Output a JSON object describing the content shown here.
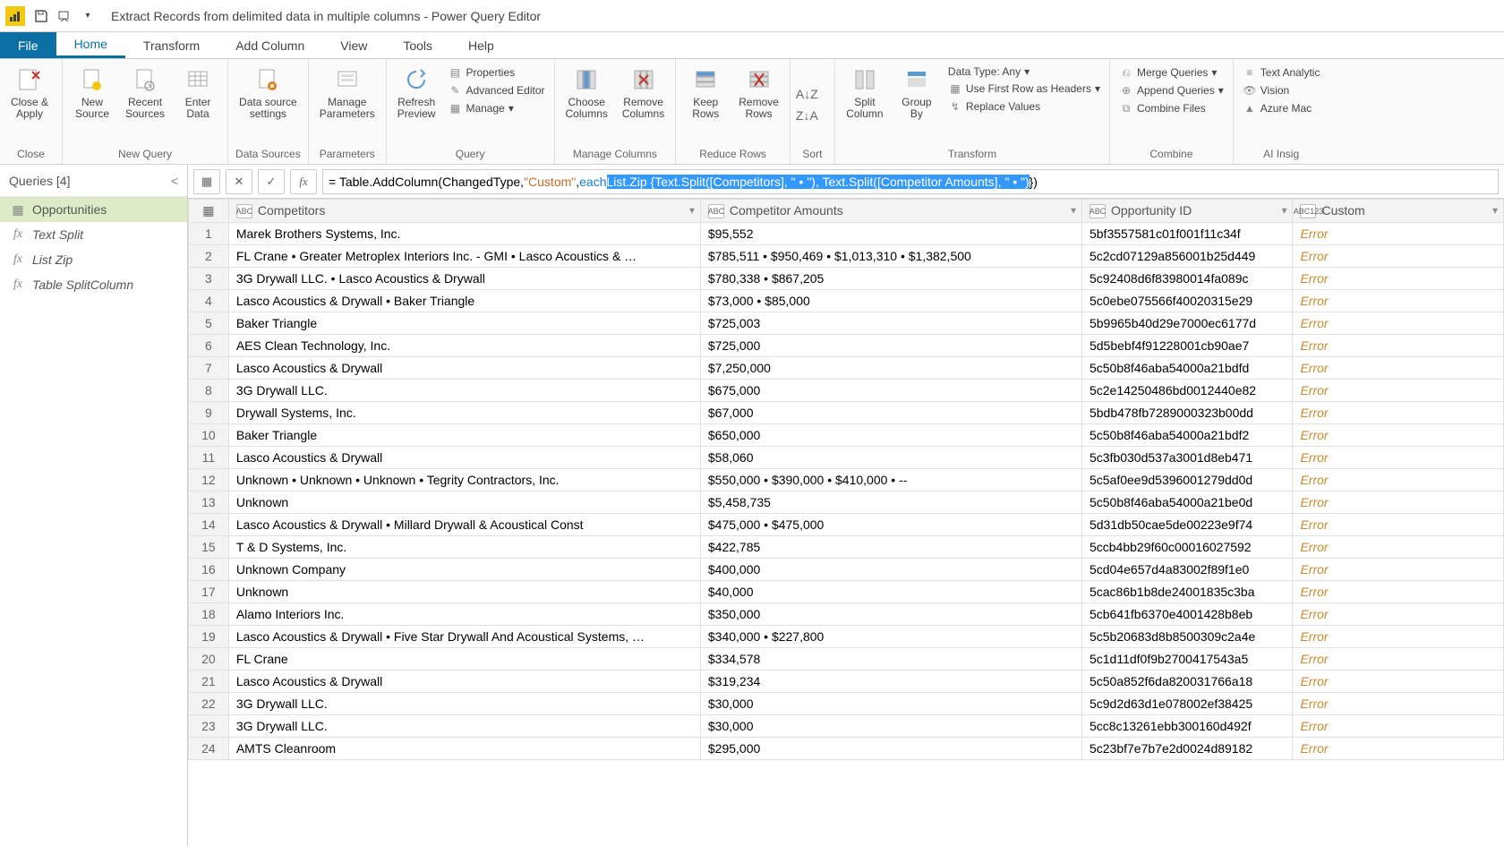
{
  "title": "Extract Records from delimited data in multiple columns - Power Query Editor",
  "menu": {
    "file": "File",
    "home": "Home",
    "transform": "Transform",
    "addcolumn": "Add Column",
    "view": "View",
    "tools": "Tools",
    "help": "Help"
  },
  "ribbon": {
    "close_apply": "Close &\nApply",
    "new_source": "New\nSource",
    "recent_sources": "Recent\nSources",
    "enter_data": "Enter\nData",
    "data_source_settings": "Data source\nsettings",
    "manage_parameters": "Manage\nParameters",
    "refresh_preview": "Refresh\nPreview",
    "properties": "Properties",
    "advanced_editor": "Advanced Editor",
    "manage": "Manage",
    "choose_columns": "Choose\nColumns",
    "remove_columns": "Remove\nColumns",
    "keep_rows": "Keep\nRows",
    "remove_rows": "Remove\nRows",
    "sort": "Sort",
    "split_column": "Split\nColumn",
    "group_by": "Group\nBy",
    "data_type": "Data Type: Any",
    "first_row_headers": "Use First Row as Headers",
    "replace_values": "Replace Values",
    "merge_queries": "Merge Queries",
    "append_queries": "Append Queries",
    "combine_files": "Combine Files",
    "text_analytics": "Text Analytic",
    "vision": "Vision",
    "azure_ml": "Azure Mac",
    "groups": {
      "close": "Close",
      "new_query": "New Query",
      "data_sources": "Data Sources",
      "parameters": "Parameters",
      "query": "Query",
      "manage_columns": "Manage Columns",
      "reduce_rows": "Reduce Rows",
      "sort": "Sort",
      "transform": "Transform",
      "combine": "Combine",
      "ai": "AI Insig"
    }
  },
  "queries_header": "Queries [4]",
  "queries": [
    {
      "label": "Opportunities",
      "active": true,
      "icon": "table"
    },
    {
      "label": "Text Split",
      "active": false,
      "icon": "fx"
    },
    {
      "label": "List Zip",
      "active": false,
      "icon": "fx"
    },
    {
      "label": "Table SplitColumn",
      "active": false,
      "icon": "fx"
    }
  ],
  "formula": {
    "prefix": "= Table.AddColumn(ChangedType, ",
    "str1": "\"Custom\"",
    "mid": ", ",
    "each": "each",
    "sel": " List.Zip {Text.Split([Competitors], \" • \"), Text.Split([Competitor Amounts], \" • \")",
    "suffix": "})"
  },
  "columns": [
    "Competitors",
    "Competitor Amounts",
    "Opportunity ID",
    "Custom"
  ],
  "col_types": [
    "ABC",
    "ABC",
    "ABC",
    "ABC123"
  ],
  "rows": [
    {
      "n": 1,
      "c": "Marek Brothers Systems, Inc.",
      "a": "$95,552",
      "id": "5bf3557581c01f001f11c34f",
      "cu": "Error"
    },
    {
      "n": 2,
      "c": "FL Crane • Greater Metroplex Interiors  Inc. - GMI • Lasco Acoustics & …",
      "a": "$785,511 • $950,469 • $1,013,310 • $1,382,500",
      "id": "5c2cd07129a856001b25d449",
      "cu": "Error"
    },
    {
      "n": 3,
      "c": "3G Drywall LLC. • Lasco Acoustics & Drywall",
      "a": "$780,338 • $867,205",
      "id": "5c92408d6f83980014fa089c",
      "cu": "Error"
    },
    {
      "n": 4,
      "c": "Lasco Acoustics & Drywall • Baker Triangle",
      "a": "$73,000 • $85,000",
      "id": "5c0ebe075566f40020315e29",
      "cu": "Error"
    },
    {
      "n": 5,
      "c": "Baker Triangle",
      "a": "$725,003",
      "id": "5b9965b40d29e7000ec6177d",
      "cu": "Error"
    },
    {
      "n": 6,
      "c": "AES Clean Technology, Inc.",
      "a": "$725,000",
      "id": "5d5bebf4f91228001cb90ae7",
      "cu": "Error"
    },
    {
      "n": 7,
      "c": "Lasco Acoustics & Drywall",
      "a": "$7,250,000",
      "id": "5c50b8f46aba54000a21bdfd",
      "cu": "Error"
    },
    {
      "n": 8,
      "c": "3G Drywall LLC.",
      "a": "$675,000",
      "id": "5c2e14250486bd0012440e82",
      "cu": "Error"
    },
    {
      "n": 9,
      "c": "Drywall Systems, Inc.",
      "a": "$67,000",
      "id": "5bdb478fb7289000323b00dd",
      "cu": "Error"
    },
    {
      "n": 10,
      "c": "Baker Triangle",
      "a": "$650,000",
      "id": "5c50b8f46aba54000a21bdf2",
      "cu": "Error"
    },
    {
      "n": 11,
      "c": "Lasco Acoustics & Drywall",
      "a": "$58,060",
      "id": "5c3fb030d537a3001d8eb471",
      "cu": "Error"
    },
    {
      "n": 12,
      "c": "Unknown • Unknown • Unknown • Tegrity Contractors, Inc.",
      "a": "$550,000 • $390,000 • $410,000 • --",
      "id": "5c5af0ee9d5396001279dd0d",
      "cu": "Error"
    },
    {
      "n": 13,
      "c": "Unknown",
      "a": "$5,458,735",
      "id": "5c50b8f46aba54000a21be0d",
      "cu": "Error"
    },
    {
      "n": 14,
      "c": "Lasco Acoustics & Drywall • Millard Drywall & Acoustical Const",
      "a": "$475,000 • $475,000",
      "id": "5d31db50cae5de00223e9f74",
      "cu": "Error"
    },
    {
      "n": 15,
      "c": "T & D Systems, Inc.",
      "a": "$422,785",
      "id": "5ccb4bb29f60c00016027592",
      "cu": "Error"
    },
    {
      "n": 16,
      "c": "Unknown Company",
      "a": "$400,000",
      "id": "5cd04e657d4a83002f89f1e0",
      "cu": "Error"
    },
    {
      "n": 17,
      "c": "Unknown",
      "a": "$40,000",
      "id": "5cac86b1b8de24001835c3ba",
      "cu": "Error"
    },
    {
      "n": 18,
      "c": "Alamo Interiors Inc.",
      "a": "$350,000",
      "id": "5cb641fb6370e4001428b8eb",
      "cu": "Error"
    },
    {
      "n": 19,
      "c": "Lasco Acoustics & Drywall • Five Star Drywall And Acoustical Systems, …",
      "a": "$340,000 • $227,800",
      "id": "5c5b20683d8b8500309c2a4e",
      "cu": "Error"
    },
    {
      "n": 20,
      "c": "FL Crane",
      "a": "$334,578",
      "id": "5c1d11df0f9b2700417543a5",
      "cu": "Error"
    },
    {
      "n": 21,
      "c": "Lasco Acoustics & Drywall",
      "a": "$319,234",
      "id": "5c50a852f6da820031766a18",
      "cu": "Error"
    },
    {
      "n": 22,
      "c": "3G Drywall LLC.",
      "a": "$30,000",
      "id": "5c9d2d63d1e078002ef38425",
      "cu": "Error"
    },
    {
      "n": 23,
      "c": "3G Drywall LLC.",
      "a": "$30,000",
      "id": "5cc8c13261ebb300160d492f",
      "cu": "Error"
    },
    {
      "n": 24,
      "c": "AMTS Cleanroom",
      "a": "$295,000",
      "id": "5c23bf7e7b7e2d0024d89182",
      "cu": "Error"
    }
  ]
}
